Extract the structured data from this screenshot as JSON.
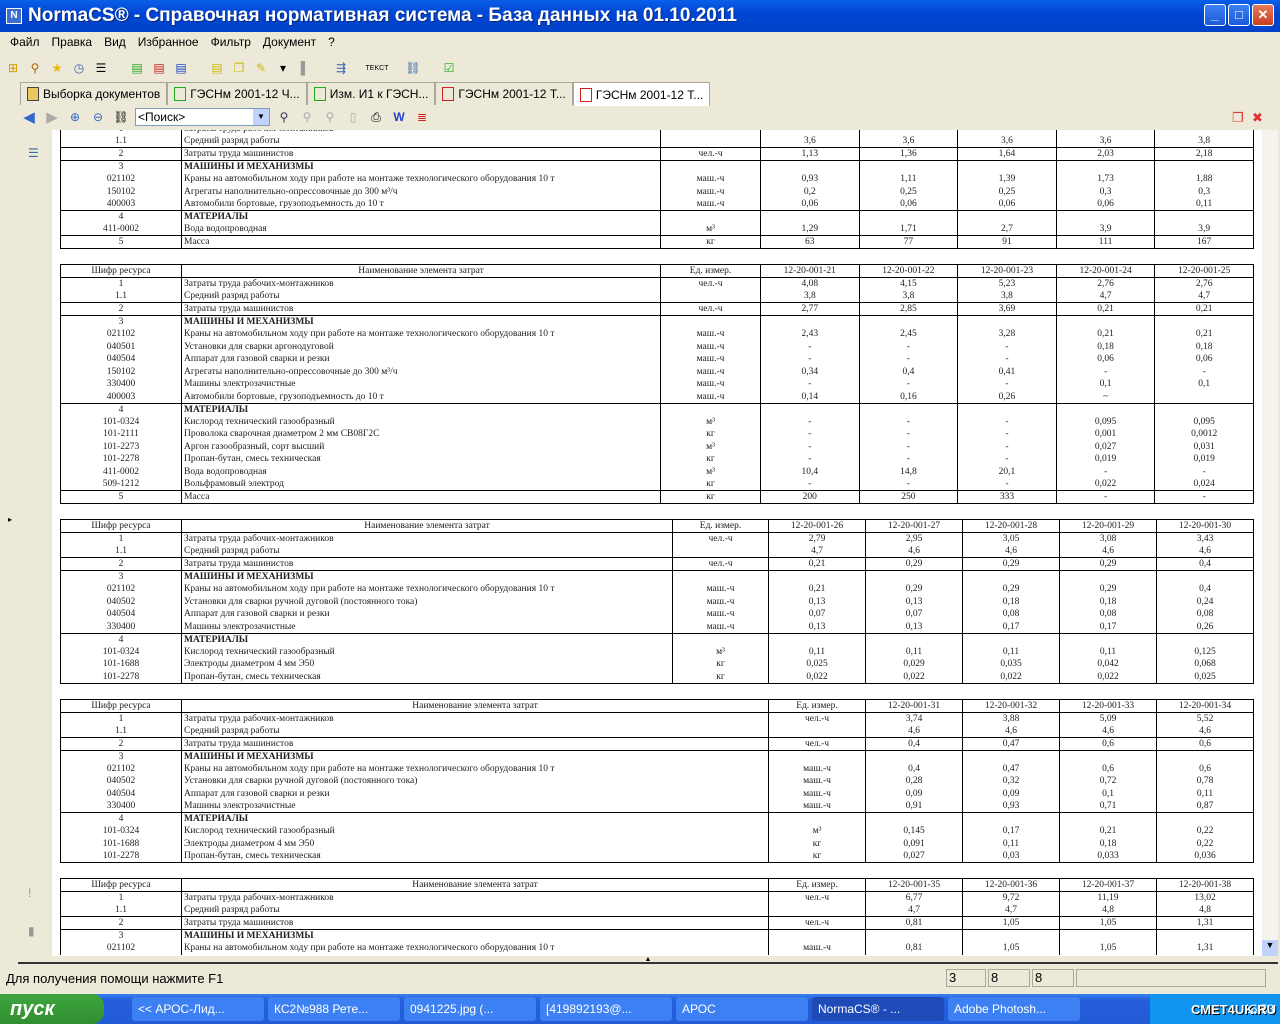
{
  "window": {
    "title": "NormaCS® - Справочная нормативная система - База данных на 01.10.2011",
    "app_icon": "N"
  },
  "menu": [
    "Файл",
    "Правка",
    "Вид",
    "Избранное",
    "Фильтр",
    "Документ",
    "?"
  ],
  "tabs": [
    {
      "label": "Выборка документов",
      "icon": "folder-icon"
    },
    {
      "label": "ГЭСНм 2001-12 Ч...",
      "icon": "green-doc-icon"
    },
    {
      "label": "Изм. И1  к ГЭСН...",
      "icon": "green-doc-icon"
    },
    {
      "label": "ГЭСНм 2001-12 Т...",
      "icon": "red-doc-icon"
    },
    {
      "label": "ГЭСНм 2001-12 Т...",
      "icon": "red-doc-icon",
      "active": true
    }
  ],
  "search": {
    "value": "<Поиск>"
  },
  "table_header": {
    "code": "Шифр ресурса",
    "name": "Наименование элемента затрат",
    "unit": "Ед. измер."
  },
  "tables": [
    {
      "layout": "a",
      "codes": [],
      "groups": [
        [
          {
            "c": "1",
            "n": "Затраты труда рабочих-монтажников",
            "u": "",
            "v": [
              "",
              "",
              "",
              "",
              ""
            ]
          },
          {
            "c": "1.1",
            "n": "Средний разряд работы",
            "u": "",
            "v": [
              "3,6",
              "3,6",
              "3,6",
              "3,6",
              "3,8"
            ]
          }
        ],
        [
          {
            "c": "2",
            "n": "Затраты труда машинистов",
            "u": "чел.-ч",
            "v": [
              "1,13",
              "1,36",
              "1,64",
              "2,03",
              "2,18"
            ]
          }
        ],
        [
          {
            "c": "3",
            "n": "МАШИНЫ И МЕХАНИЗМЫ",
            "u": "",
            "v": [
              "",
              "",
              "",
              "",
              ""
            ],
            "b": true
          },
          {
            "c": "021102",
            "n": "Краны на автомобильном ходу при работе на монтаже технологического оборудования 10 т",
            "u": "маш.-ч",
            "v": [
              "0,93",
              "1,11",
              "1,39",
              "1,73",
              "1,88"
            ]
          },
          {
            "c": "150102",
            "n": "Агрегаты наполнительно-опрессовочные до 300 м³/ч",
            "u": "маш.-ч",
            "v": [
              "0,2",
              "0,25",
              "0,25",
              "0,3",
              "0,3"
            ]
          },
          {
            "c": "400003",
            "n": "Автомобили бортовые, грузоподъемность до 10 т",
            "u": "маш.-ч",
            "v": [
              "0,06",
              "0,06",
              "0,06",
              "0,06",
              "0,11"
            ]
          }
        ],
        [
          {
            "c": "4",
            "n": "МАТЕРИАЛЫ",
            "u": "",
            "v": [
              "",
              "",
              "",
              "",
              ""
            ],
            "b": true
          },
          {
            "c": "411-0002",
            "n": "Вода водопроводная",
            "u": "м³",
            "v": [
              "1,29",
              "1,71",
              "2,7",
              "3,9",
              "3,9"
            ]
          }
        ],
        [
          {
            "c": "5",
            "n": "Масса",
            "u": "кг",
            "v": [
              "63",
              "77",
              "91",
              "111",
              "167"
            ]
          }
        ]
      ]
    },
    {
      "layout": "a",
      "codes": [
        "12-20-001-21",
        "12-20-001-22",
        "12-20-001-23",
        "12-20-001-24",
        "12-20-001-25"
      ],
      "groups": [
        [
          {
            "c": "1",
            "n": "Затраты труда рабочих-монтажников",
            "u": "чел.-ч",
            "v": [
              "4,08",
              "4,15",
              "5,23",
              "2,76",
              "2,76"
            ]
          },
          {
            "c": "1.1",
            "n": "Средний разряд работы",
            "u": "",
            "v": [
              "3,8",
              "3,8",
              "3,8",
              "4,7",
              "4,7"
            ]
          }
        ],
        [
          {
            "c": "2",
            "n": "Затраты труда машинистов",
            "u": "чел.-ч",
            "v": [
              "2,77",
              "2,85",
              "3,69",
              "0,21",
              "0,21"
            ]
          }
        ],
        [
          {
            "c": "3",
            "n": "МАШИНЫ И МЕХАНИЗМЫ",
            "u": "",
            "v": [
              "",
              "",
              "",
              "",
              ""
            ],
            "b": true
          },
          {
            "c": "021102",
            "n": "Краны на автомобильном ходу при работе на монтаже технологического оборудования 10 т",
            "u": "маш.-ч",
            "v": [
              "2,43",
              "2,45",
              "3,28",
              "0,21",
              "0,21"
            ]
          },
          {
            "c": "040501",
            "n": "Установки для сварки аргонодуговой",
            "u": "маш.-ч",
            "v": [
              "-",
              "-",
              "-",
              "0,18",
              "0,18"
            ]
          },
          {
            "c": "040504",
            "n": "Аппарат для газовой сварки и резки",
            "u": "маш.-ч",
            "v": [
              "-",
              "-",
              "-",
              "0,06",
              "0,06"
            ]
          },
          {
            "c": "150102",
            "n": "Агрегаты наполнительно-опрессовочные до 300 м³/ч",
            "u": "маш.-ч",
            "v": [
              "0,34",
              "0,4",
              "0,41",
              "-",
              "-"
            ]
          },
          {
            "c": "330400",
            "n": "Машины электрозачистные",
            "u": "маш.-ч",
            "v": [
              "-",
              "-",
              "-",
              "0,1",
              "0,1"
            ]
          },
          {
            "c": "400003",
            "n": "Автомобили бортовые, грузоподъемность до 10 т",
            "u": "маш.-ч",
            "v": [
              "0,14",
              "0,16",
              "0,26",
              "~",
              ""
            ]
          }
        ],
        [
          {
            "c": "4",
            "n": "МАТЕРИАЛЫ",
            "u": "",
            "v": [
              "",
              "",
              "",
              "",
              ""
            ],
            "b": true
          },
          {
            "c": "101-0324",
            "n": "Кислород технический газообразный",
            "u": "м³",
            "v": [
              "-",
              "-",
              "-",
              "0,095",
              "0,095"
            ]
          },
          {
            "c": "101-2111",
            "n": "Проволока сварочная диаметром 2 мм СВ08Г2С",
            "u": "кг",
            "v": [
              "-",
              "-",
              "-",
              "0,001",
              "0,0012"
            ]
          },
          {
            "c": "101-2273",
            "n": "Аргон газообразный, сорт высший",
            "u": "м³",
            "v": [
              "-",
              "-",
              "-",
              "0,027",
              "0,031"
            ]
          },
          {
            "c": "101-2278",
            "n": "Пропан-бутан, смесь техническая",
            "u": "кг",
            "v": [
              "-",
              "-",
              "-",
              "0,019",
              "0,019"
            ]
          },
          {
            "c": "411-0002",
            "n": "Вода водопроводная",
            "u": "м³",
            "v": [
              "10,4",
              "14,8",
              "20,1",
              "-",
              "-"
            ]
          },
          {
            "c": "509-1212",
            "n": "Вольфрамовый электрод",
            "u": "кг",
            "v": [
              "-",
              "-",
              "-",
              "0,022",
              "0,024"
            ]
          }
        ],
        [
          {
            "c": "5",
            "n": "Масса",
            "u": "кг",
            "v": [
              "200",
              "250",
              "333",
              "-",
              "-"
            ]
          }
        ]
      ]
    },
    {
      "layout": "b",
      "codes": [
        "12-20-001-26",
        "12-20-001-27",
        "12-20-001-28",
        "12-20-001-29",
        "12-20-001-30"
      ],
      "groups": [
        [
          {
            "c": "1",
            "n": "Затраты труда рабочих-монтажников",
            "u": "чел.-ч",
            "v": [
              "2,79",
              "2,95",
              "3,05",
              "3,08",
              "3,43"
            ]
          },
          {
            "c": "1.1",
            "n": "Средний разряд работы",
            "u": "",
            "v": [
              "4,7",
              "4,6",
              "4,6",
              "4,6",
              "4,6"
            ]
          }
        ],
        [
          {
            "c": "2",
            "n": "Затраты труда машинистов",
            "u": "чел.-ч",
            "v": [
              "0,21",
              "0,29",
              "0,29",
              "0,29",
              "0,4"
            ]
          }
        ],
        [
          {
            "c": "3",
            "n": "МАШИНЫ И МЕХАНИЗМЫ",
            "u": "",
            "v": [
              "",
              "",
              "",
              "",
              ""
            ],
            "b": true
          },
          {
            "c": "021102",
            "n": "Краны на автомобильном ходу при работе на монтаже технологического оборудования 10 т",
            "u": "маш.-ч",
            "v": [
              "0,21",
              "0,29",
              "0,29",
              "0,29",
              "0,4"
            ]
          },
          {
            "c": "040502",
            "n": "Установки для сварки ручной дуговой (постоянного тока)",
            "u": "маш.-ч",
            "v": [
              "0,13",
              "0,13",
              "0,18",
              "0,18",
              "0,24"
            ]
          },
          {
            "c": "040504",
            "n": "Аппарат для газовой сварки и резки",
            "u": "маш.-ч",
            "v": [
              "0,07",
              "0,07",
              "0,08",
              "0,08",
              "0,08"
            ]
          },
          {
            "c": "330400",
            "n": "Машины электрозачистные",
            "u": "маш.-ч",
            "v": [
              "0,13",
              "0,13",
              "0,17",
              "0,17",
              "0,26"
            ]
          }
        ],
        [
          {
            "c": "4",
            "n": "МАТЕРИАЛЫ",
            "u": "",
            "v": [
              "",
              "",
              "",
              "",
              ""
            ],
            "b": true
          },
          {
            "c": "101-0324",
            "n": "Кислород технический газообразный",
            "u": "м³",
            "v": [
              "0,11",
              "0,11",
              "0,11",
              "0,11",
              "0,125"
            ]
          },
          {
            "c": "101-1688",
            "n": "Электроды диаметром 4 мм Э50",
            "u": "кг",
            "v": [
              "0,025",
              "0,029",
              "0,035",
              "0,042",
              "0,068"
            ]
          },
          {
            "c": "101-2278",
            "n": "Пропан-бутан, смесь техническая",
            "u": "кг",
            "v": [
              "0,022",
              "0,022",
              "0,022",
              "0,022",
              "0,025"
            ]
          }
        ]
      ]
    },
    {
      "layout": "c",
      "codes": [
        "12-20-001-31",
        "12-20-001-32",
        "12-20-001-33",
        "12-20-001-34"
      ],
      "groups": [
        [
          {
            "c": "1",
            "n": "Затраты труда рабочих-монтажников",
            "u": "чел.-ч",
            "v": [
              "3,74",
              "3,88",
              "5,09",
              "5,52"
            ]
          },
          {
            "c": "1.1",
            "n": "Средний разряд работы",
            "u": "",
            "v": [
              "4,6",
              "4,6",
              "4,6",
              "4,6"
            ]
          }
        ],
        [
          {
            "c": "2",
            "n": "Затраты труда машинистов",
            "u": "чел.-ч",
            "v": [
              "0,4",
              "0,47",
              "0,6",
              "0,6"
            ]
          }
        ],
        [
          {
            "c": "3",
            "n": "МАШИНЫ И МЕХАНИЗМЫ",
            "u": "",
            "v": [
              "",
              "",
              "",
              ""
            ],
            "b": true
          },
          {
            "c": "021102",
            "n": "Краны на автомобильном ходу при работе на монтаже технологического оборудования 10 т",
            "u": "маш.-ч",
            "v": [
              "0,4",
              "0,47",
              "0,6",
              "0,6"
            ]
          },
          {
            "c": "040502",
            "n": "Установки для сварки ручной дуговой (постоянного тока)",
            "u": "маш.-ч",
            "v": [
              "0,28",
              "0,32",
              "0,72",
              "0,78"
            ]
          },
          {
            "c": "040504",
            "n": "Аппарат для газовой сварки и резки",
            "u": "маш.-ч",
            "v": [
              "0,09",
              "0,09",
              "0,1",
              "0,11"
            ]
          },
          {
            "c": "330400",
            "n": "Машины электрозачистные",
            "u": "маш.-ч",
            "v": [
              "0,91",
              "0,93",
              "0,71",
              "0,87"
            ]
          }
        ],
        [
          {
            "c": "4",
            "n": "МАТЕРИАЛЫ",
            "u": "",
            "v": [
              "",
              "",
              "",
              ""
            ],
            "b": true
          },
          {
            "c": "101-0324",
            "n": "Кислород технический газообразный",
            "u": "м³",
            "v": [
              "0,145",
              "0,17",
              "0,21",
              "0,22"
            ]
          },
          {
            "c": "101-1688",
            "n": "Электроды диаметром 4 мм Э50",
            "u": "кг",
            "v": [
              "0,091",
              "0,11",
              "0,18",
              "0,22"
            ]
          },
          {
            "c": "101-2278",
            "n": "Пропан-бутан, смесь техническая",
            "u": "кг",
            "v": [
              "0,027",
              "0,03",
              "0,033",
              "0,036"
            ]
          }
        ]
      ]
    },
    {
      "layout": "c",
      "codes": [
        "12-20-001-35",
        "12-20-001-36",
        "12-20-001-37",
        "12-20-001-38"
      ],
      "groups": [
        [
          {
            "c": "1",
            "n": "Затраты труда рабочих-монтажников",
            "u": "чел.-ч",
            "v": [
              "6,77",
              "9,72",
              "11,19",
              "13,02"
            ]
          },
          {
            "c": "1.1",
            "n": "Средний разряд работы",
            "u": "",
            "v": [
              "4,7",
              "4,7",
              "4,8",
              "4,8"
            ]
          }
        ],
        [
          {
            "c": "2",
            "n": "Затраты труда машинистов",
            "u": "чел.-ч",
            "v": [
              "0,81",
              "1,05",
              "1,05",
              "1,31"
            ]
          }
        ],
        [
          {
            "c": "3",
            "n": "МАШИНЫ И МЕХАНИЗМЫ",
            "u": "",
            "v": [
              "",
              "",
              "",
              ""
            ],
            "b": true
          },
          {
            "c": "021102",
            "n": "Краны на автомобильном ходу при работе на монтаже технологического оборудования 10 т",
            "u": "маш.-ч",
            "v": [
              "0,81",
              "1,05",
              "1,05",
              "1,31"
            ]
          }
        ]
      ]
    }
  ],
  "status": {
    "help": "Для получения помощи нажмите F1",
    "p1": "3",
    "p2": "8",
    "p3": "8"
  },
  "taskbar": {
    "start": "пуск",
    "items": [
      "<< АРОС-Лид...",
      "КС2№988 Рете...",
      "0941225.jpg (...",
      "[419892193@...",
      "АРОС",
      "NormaCS® - ...",
      "Adobe Photosh..."
    ],
    "active_index": 5,
    "clock": "16:58",
    "watermark": "СМЕТ4UK.RU"
  }
}
